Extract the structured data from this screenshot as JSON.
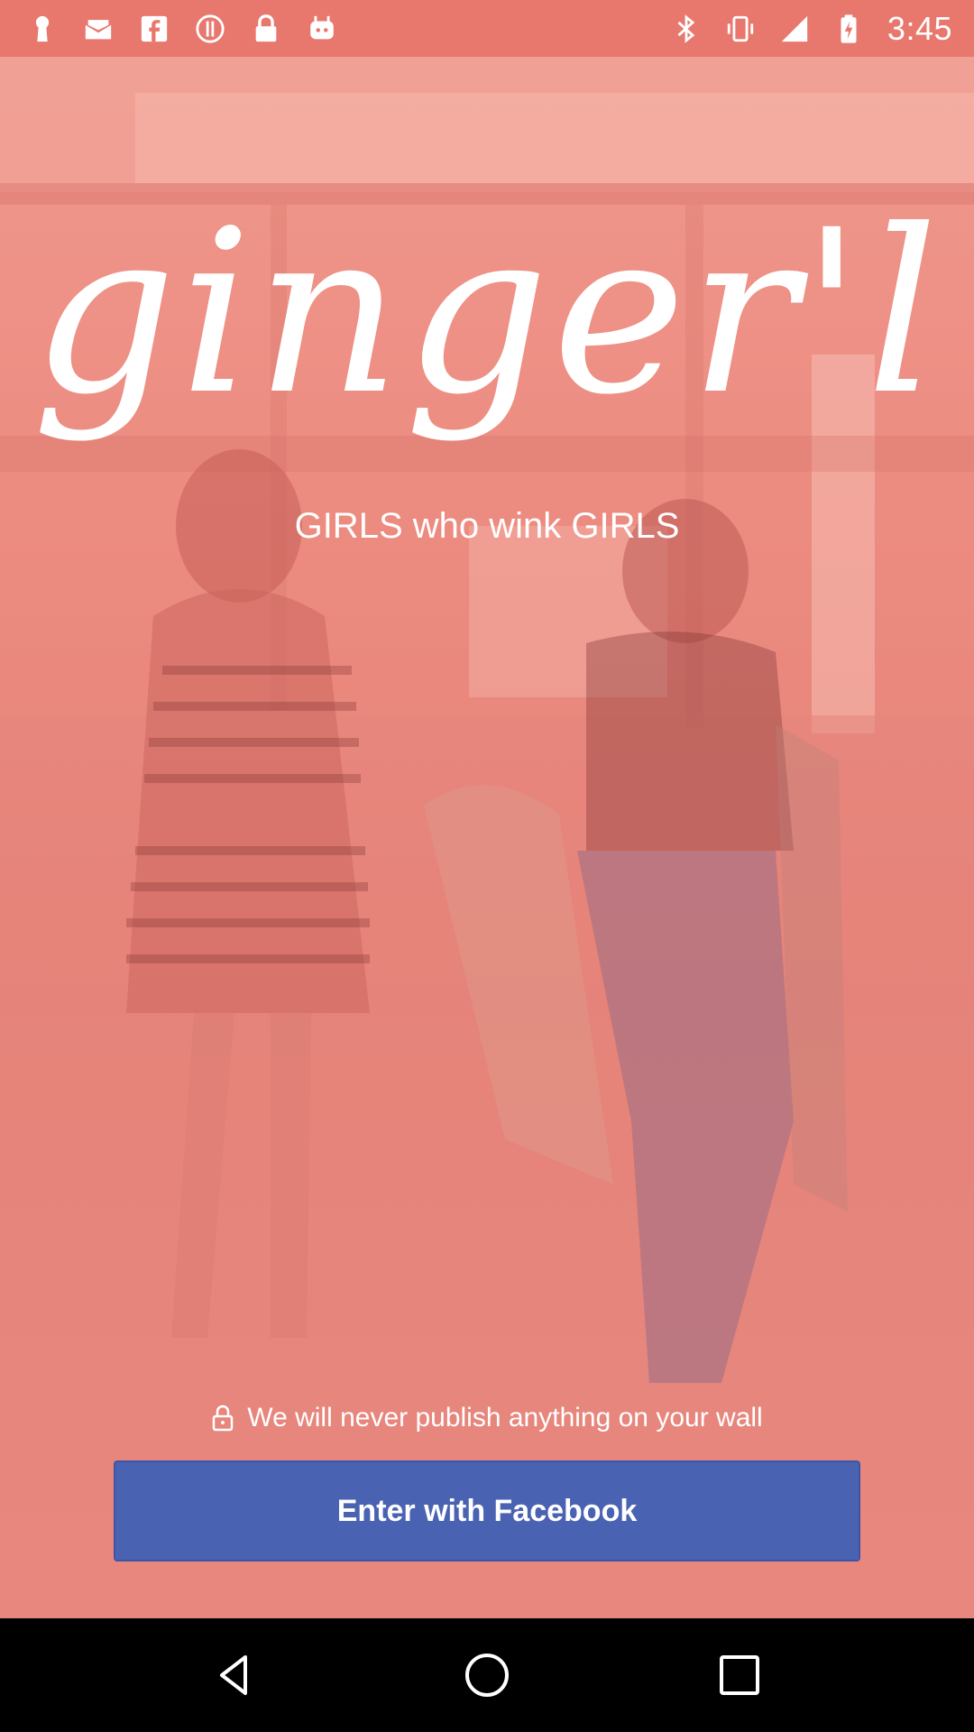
{
  "status_bar": {
    "time": "3:45",
    "left_icons": [
      "keyhole-icon",
      "mail-icon",
      "facebook-icon",
      "alert-icon",
      "lock-icon",
      "android-icon"
    ],
    "right_icons": [
      "bluetooth-icon",
      "vibrate-icon",
      "signal-icon",
      "battery-icon"
    ]
  },
  "app": {
    "logo_text": "ginger'l",
    "tagline": "GIRLS who wink GIRLS",
    "privacy_note": "We will never publish anything on your wall",
    "login_button": "Enter with Facebook"
  },
  "colors": {
    "overlay": "#ec8b80",
    "status_bar": "#e8786d",
    "facebook_blue": "#4a62b2",
    "text": "#ffffff"
  },
  "nav_bar": {
    "buttons": [
      "back-icon",
      "home-icon",
      "recents-icon"
    ]
  }
}
